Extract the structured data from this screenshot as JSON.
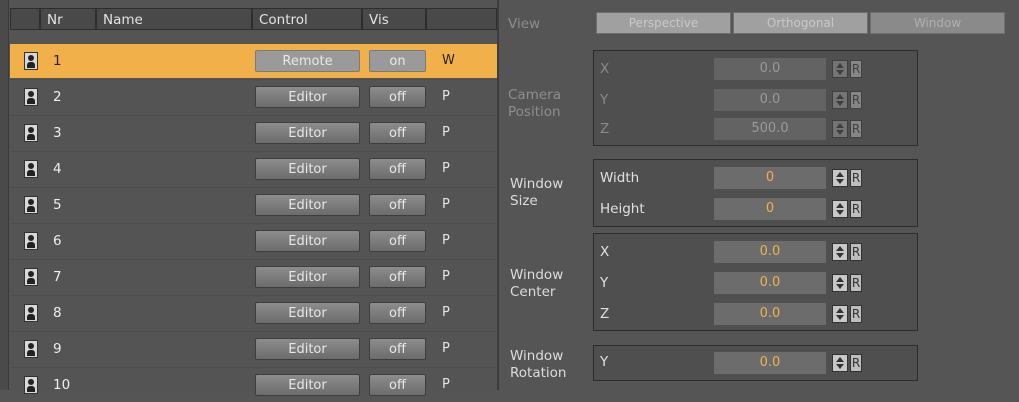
{
  "header": {
    "nr": "Nr",
    "name": "Name",
    "control": "Control",
    "vis": "Vis"
  },
  "rows": [
    {
      "nr": "1",
      "control": "Remote",
      "vis": "on",
      "type": "W"
    },
    {
      "nr": "2",
      "control": "Editor",
      "vis": "off",
      "type": "P"
    },
    {
      "nr": "3",
      "control": "Editor",
      "vis": "off",
      "type": "P"
    },
    {
      "nr": "4",
      "control": "Editor",
      "vis": "off",
      "type": "P"
    },
    {
      "nr": "5",
      "control": "Editor",
      "vis": "off",
      "type": "P"
    },
    {
      "nr": "6",
      "control": "Editor",
      "vis": "off",
      "type": "P"
    },
    {
      "nr": "7",
      "control": "Editor",
      "vis": "off",
      "type": "P"
    },
    {
      "nr": "8",
      "control": "Editor",
      "vis": "off",
      "type": "P"
    },
    {
      "nr": "9",
      "control": "Editor",
      "vis": "off",
      "type": "P"
    },
    {
      "nr": "10",
      "control": "Editor",
      "vis": "off",
      "type": "P"
    }
  ],
  "view": {
    "label": "View",
    "buttons": [
      "Perspective",
      "Orthogonal",
      "Window"
    ],
    "active": "Window"
  },
  "camera_position": {
    "label_line1": "Camera",
    "label_line2": "Position",
    "fields": [
      {
        "axis": "X",
        "value": "0.0"
      },
      {
        "axis": "Y",
        "value": "0.0"
      },
      {
        "axis": "Z",
        "value": "500.0"
      }
    ]
  },
  "window_size": {
    "label_line1": "Window",
    "label_line2": "Size",
    "fields": [
      {
        "axis": "Width",
        "value": "0"
      },
      {
        "axis": "Height",
        "value": "0"
      }
    ]
  },
  "window_center": {
    "label_line1": "Window",
    "label_line2": "Center",
    "fields": [
      {
        "axis": "X",
        "value": "0.0"
      },
      {
        "axis": "Y",
        "value": "0.0"
      },
      {
        "axis": "Z",
        "value": "0.0"
      }
    ]
  },
  "window_rotation": {
    "label_line1": "Window",
    "label_line2": "Rotation",
    "fields": [
      {
        "axis": "Y",
        "value": "0.0"
      }
    ]
  },
  "reset_label": "R",
  "colors": {
    "accent": "#f2b04a",
    "panel": "#545454"
  }
}
